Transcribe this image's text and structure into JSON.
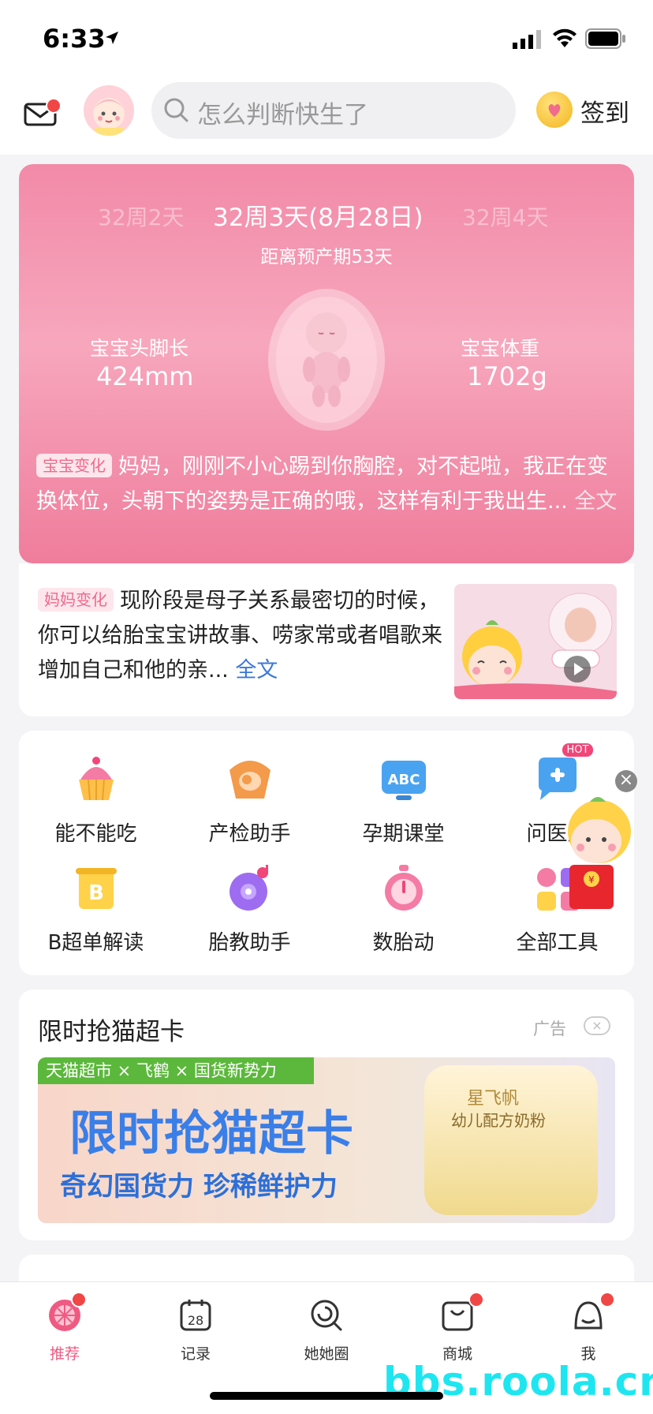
{
  "status_bar": {
    "time": "6:33"
  },
  "header": {
    "search_placeholder": "怎么判断快生了",
    "checkin_label": "签到"
  },
  "pregnancy": {
    "week_prev": "32周2天",
    "week_current": "32周3天(8月28日)",
    "week_next": "32周4天",
    "due_countdown": "距离预产期53天",
    "length_label": "宝宝头脚长",
    "length_value": "424mm",
    "weight_label": "宝宝体重",
    "weight_value": "1702g",
    "baby_tag": "宝宝变化",
    "baby_text": "妈妈，刚刚不小心踢到你胸腔，对不起啦，我正在变换体位，头朝下的姿势是正确的哦，这样有利于我出生...",
    "baby_more": "全文"
  },
  "mom": {
    "tag": "妈妈变化",
    "text": "现阶段是母子关系最密切的时候，你可以给胎宝宝讲故事、唠家常或者唱歌来增加自己和他的亲...",
    "more": "全文"
  },
  "tools": [
    {
      "label": "能不能吃",
      "icon": "cupcake-icon"
    },
    {
      "label": "产检助手",
      "icon": "ultrasound-icon"
    },
    {
      "label": "孕期课堂",
      "icon": "abc-board-icon"
    },
    {
      "label": "问医生",
      "icon": "doctor-chat-icon",
      "badge": "HOT"
    },
    {
      "label": "B超单解读",
      "icon": "b-scroll-icon"
    },
    {
      "label": "胎教助手",
      "icon": "music-disc-icon"
    },
    {
      "label": "数胎动",
      "icon": "stopwatch-icon"
    },
    {
      "label": "全部工具",
      "icon": "grid-tools-icon"
    }
  ],
  "ad": {
    "title": "限时抢猫超卡",
    "tag": "广告",
    "banner_strip": "天猫超市 × 飞鹤 × 国货新势力",
    "banner_headline": "限时抢猫超卡",
    "banner_sub": "奇幻国货力 珍稀鲜护力",
    "product_brand": "星飞帆",
    "product_name": "幼儿配方奶粉"
  },
  "tabbar": [
    {
      "label": "推荐",
      "active": true,
      "badge": true
    },
    {
      "label": "记录",
      "active": false,
      "badge": false
    },
    {
      "label": "她她圈",
      "active": false,
      "badge": false
    },
    {
      "label": "商城",
      "active": false,
      "badge": true
    },
    {
      "label": "我",
      "active": false,
      "badge": true
    }
  ],
  "tab_calendar_day": "28",
  "watermark": "bbs.roola.cn",
  "colors": {
    "accent": "#ef5a82",
    "hero_pink": "#f28aa8",
    "badge_red": "#f04646",
    "link_blue": "#3c78d8"
  }
}
